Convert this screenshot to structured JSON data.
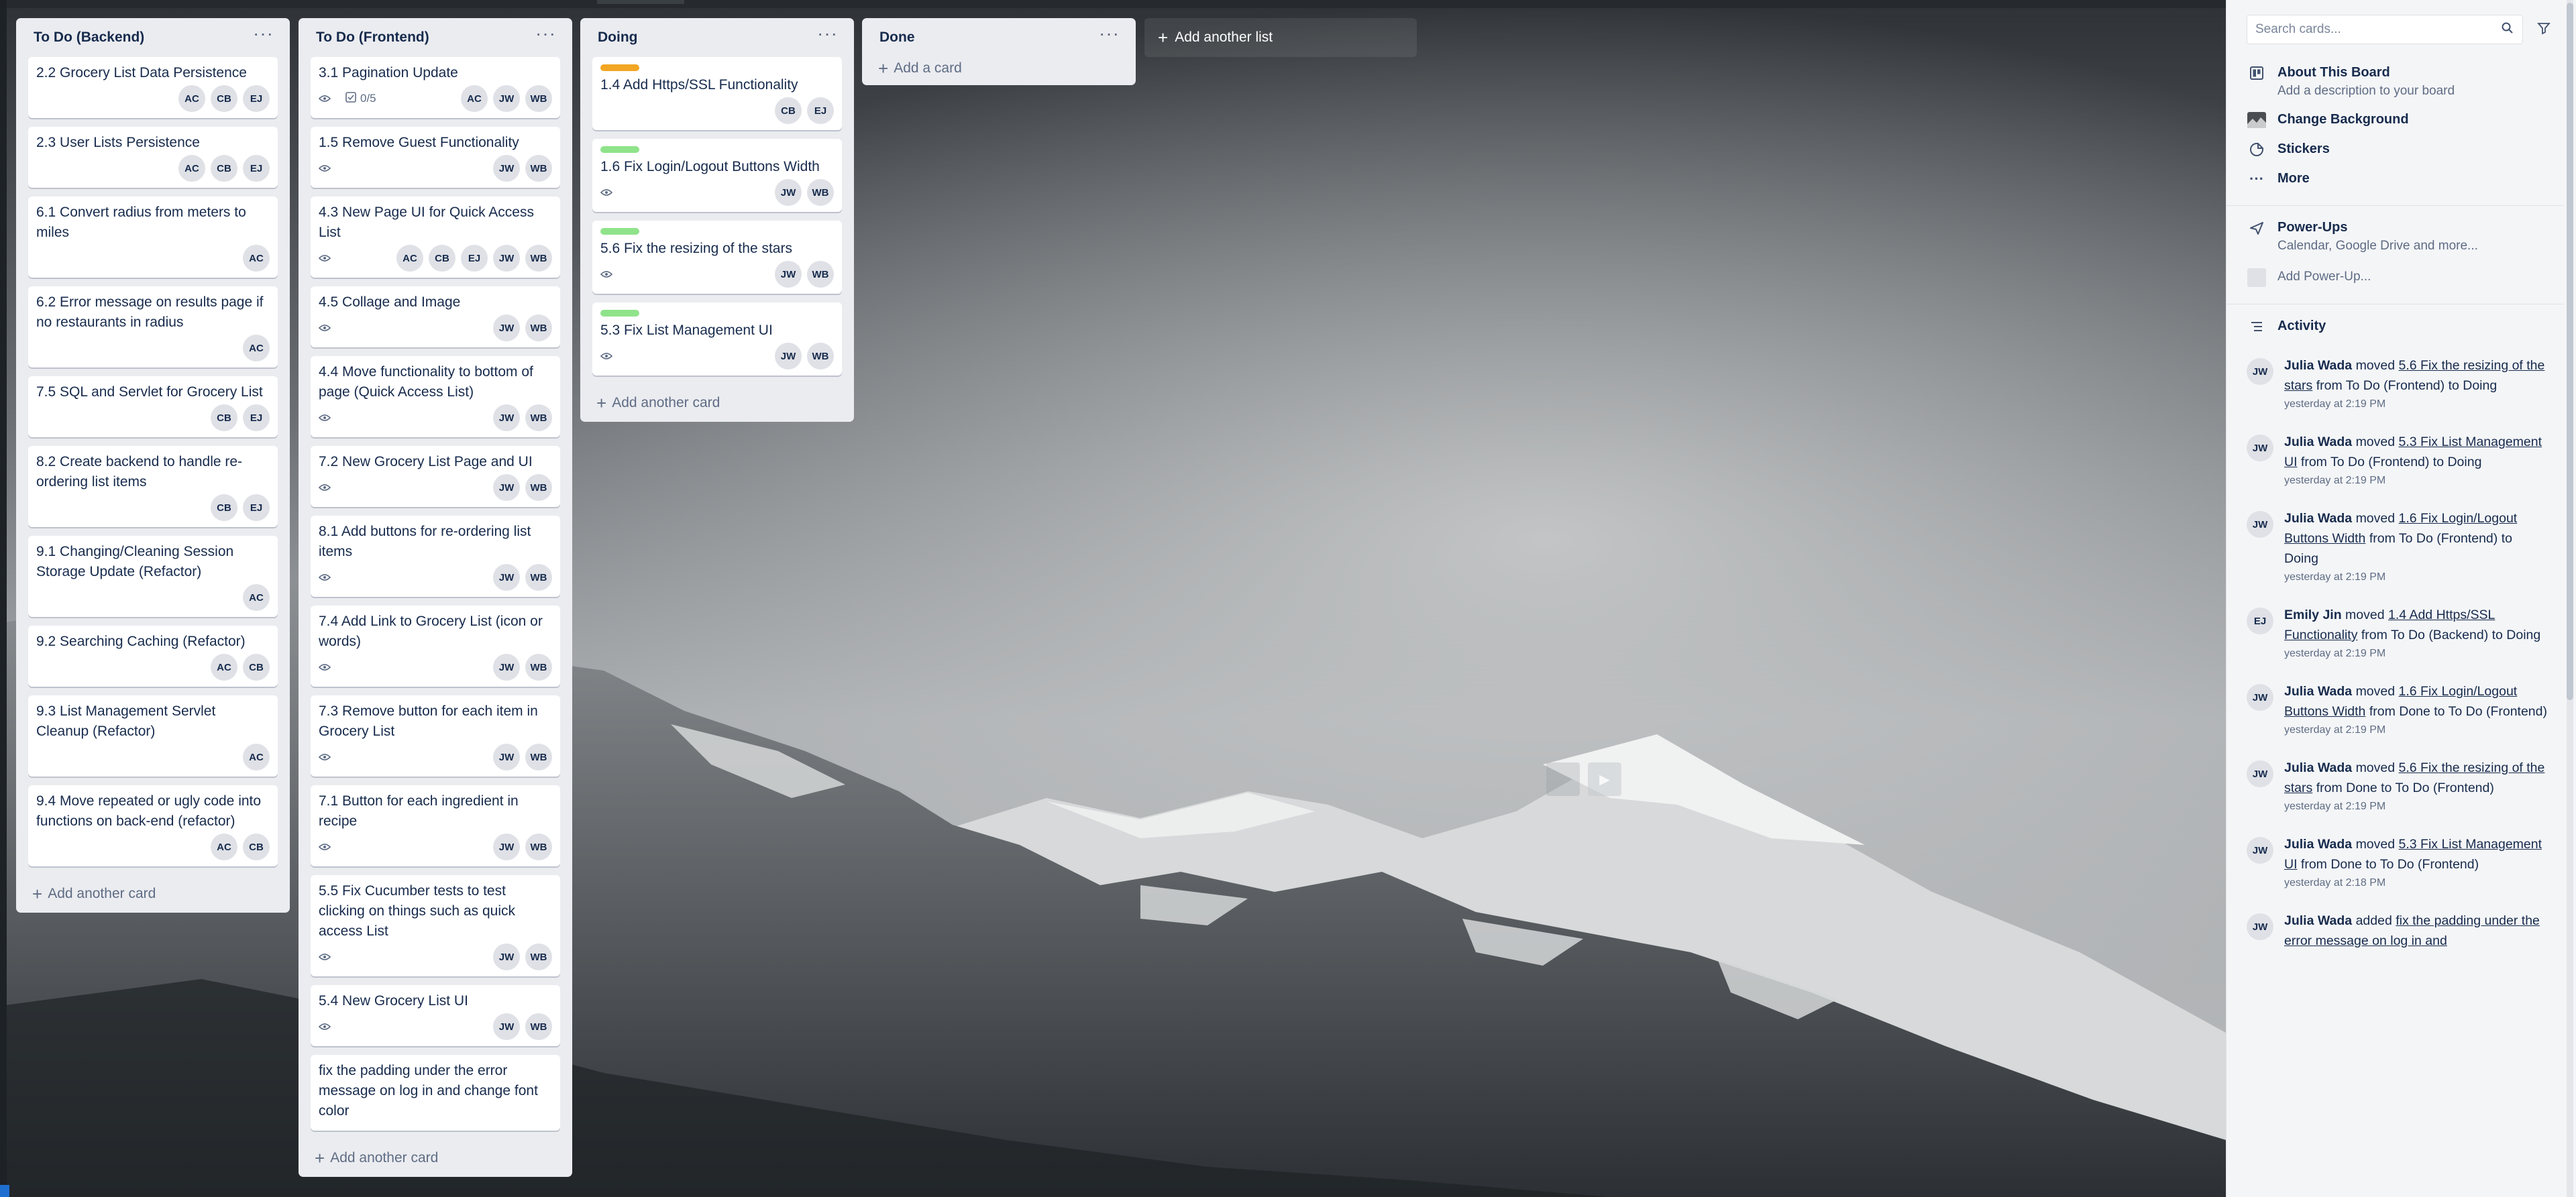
{
  "board": {
    "add_list_label": "Add another list",
    "lists": [
      {
        "title": "To Do (Backend)",
        "add_card_label": "Add another card",
        "cards": [
          {
            "title": "2.2 Grocery List Data Persistence",
            "members": [
              "AC",
              "CB",
              "EJ"
            ]
          },
          {
            "title": "2.3 User Lists Persistence",
            "members": [
              "AC",
              "CB",
              "EJ"
            ]
          },
          {
            "title": "6.1 Convert radius from meters to miles",
            "members": [
              "AC"
            ]
          },
          {
            "title": "6.2 Error message on results page if no restaurants in radius",
            "members": [
              "AC"
            ]
          },
          {
            "title": "7.5 SQL and Servlet for Grocery List",
            "members": [
              "CB",
              "EJ"
            ]
          },
          {
            "title": "8.2 Create backend to handle re-ordering list items",
            "members": [
              "CB",
              "EJ"
            ]
          },
          {
            "title": "9.1 Changing/Cleaning Session Storage Update (Refactor)",
            "members": [
              "AC"
            ]
          },
          {
            "title": "9.2 Searching Caching (Refactor)",
            "members": [
              "AC",
              "CB"
            ]
          },
          {
            "title": "9.3 List Management Servlet Cleanup (Refactor)",
            "members": [
              "AC"
            ]
          },
          {
            "title": "9.4 Move repeated or ugly code into functions on back-end (refactor)",
            "members": [
              "AC",
              "CB"
            ]
          }
        ]
      },
      {
        "title": "To Do (Frontend)",
        "add_card_label": "Add another card",
        "cards": [
          {
            "title": "3.1 Pagination Update",
            "watch": true,
            "checklist": "0/5",
            "members": [
              "AC",
              "JW",
              "WB"
            ]
          },
          {
            "title": "1.5 Remove Guest Functionality",
            "watch": true,
            "members": [
              "JW",
              "WB"
            ]
          },
          {
            "title": "4.3 New Page UI for Quick Access List",
            "watch": true,
            "members": [
              "AC",
              "CB",
              "EJ",
              "JW",
              "WB"
            ]
          },
          {
            "title": "4.5 Collage and Image",
            "watch": true,
            "members": [
              "JW",
              "WB"
            ]
          },
          {
            "title": "4.4 Move functionality to bottom of page (Quick Access List)",
            "watch": true,
            "members": [
              "JW",
              "WB"
            ]
          },
          {
            "title": "7.2 New Grocery List Page and UI",
            "watch": true,
            "members": [
              "JW",
              "WB"
            ]
          },
          {
            "title": "8.1 Add buttons for re-ordering list items",
            "watch": true,
            "members": [
              "JW",
              "WB"
            ]
          },
          {
            "title": "7.4 Add Link to Grocery List (icon or words)",
            "watch": true,
            "members": [
              "JW",
              "WB"
            ]
          },
          {
            "title": "7.3 Remove button for each item in Grocery List",
            "watch": true,
            "members": [
              "JW",
              "WB"
            ]
          },
          {
            "title": "7.1 Button for each ingredient in recipe",
            "watch": true,
            "members": [
              "JW",
              "WB"
            ]
          },
          {
            "title": "5.5 Fix Cucumber tests to test clicking on things such as quick access List",
            "watch": true,
            "members": [
              "JW",
              "WB"
            ]
          },
          {
            "title": "5.4 New Grocery List UI",
            "watch": true,
            "members": [
              "JW",
              "WB"
            ]
          },
          {
            "title": "fix the padding under the error message on log in and change font color",
            "members": []
          }
        ]
      },
      {
        "title": "Doing",
        "add_card_label": "Add another card",
        "cards": [
          {
            "title": "1.4 Add Https/SSL Functionality",
            "label_color": "#f2a623",
            "members": [
              "CB",
              "EJ"
            ]
          },
          {
            "title": "1.6 Fix Login/Logout Buttons Width",
            "label_color": "#8fe38a",
            "watch": true,
            "members": [
              "JW",
              "WB"
            ]
          },
          {
            "title": "5.6 Fix the resizing of the stars",
            "label_color": "#8fe38a",
            "watch": true,
            "members": [
              "JW",
              "WB"
            ]
          },
          {
            "title": "5.3 Fix List Management UI",
            "label_color": "#8fe38a",
            "watch": true,
            "members": [
              "JW",
              "WB"
            ]
          }
        ]
      },
      {
        "title": "Done",
        "add_card_label": "Add a card",
        "cards": []
      }
    ]
  },
  "sidebar": {
    "search_placeholder": "Search cards...",
    "menu": [
      {
        "icon": "board-icon",
        "title": "About This Board",
        "desc": "Add a description to your board"
      },
      {
        "icon": "background-thumbnail-icon",
        "title": "Change Background",
        "desc": ""
      },
      {
        "icon": "sticker-icon",
        "title": "Stickers",
        "desc": ""
      },
      {
        "icon": "more-icon",
        "title": "More",
        "desc": ""
      }
    ],
    "powerups": {
      "title": "Power-Ups",
      "desc": "Calendar, Google Drive and more...",
      "add_label": "Add Power-Up..."
    },
    "activity_title": "Activity",
    "activity": [
      {
        "initials": "JW",
        "user": "Julia Wada",
        "verb": "moved",
        "card": "5.6 Fix the resizing of the stars",
        "rest": "from To Do (Frontend) to Doing",
        "time": "yesterday at 2:19 PM"
      },
      {
        "initials": "JW",
        "user": "Julia Wada",
        "verb": "moved",
        "card": "5.3 Fix List Management UI",
        "rest": "from To Do (Frontend) to Doing",
        "time": "yesterday at 2:19 PM"
      },
      {
        "initials": "JW",
        "user": "Julia Wada",
        "verb": "moved",
        "card": "1.6 Fix Login/Logout Buttons Width",
        "rest": "from To Do (Frontend) to Doing",
        "time": "yesterday at 2:19 PM"
      },
      {
        "initials": "EJ",
        "user": "Emily Jin",
        "verb": "moved",
        "card": "1.4 Add Https/SSL Functionality",
        "rest": "from To Do (Backend) to Doing",
        "time": "yesterday at 2:19 PM"
      },
      {
        "initials": "JW",
        "user": "Julia Wada",
        "verb": "moved",
        "card": "1.6 Fix Login/Logout Buttons Width",
        "rest": "from Done to To Do (Frontend)",
        "time": "yesterday at 2:19 PM"
      },
      {
        "initials": "JW",
        "user": "Julia Wada",
        "verb": "moved",
        "card": "5.6 Fix the resizing of the stars",
        "rest": "from Done to To Do (Frontend)",
        "time": "yesterday at 2:19 PM"
      },
      {
        "initials": "JW",
        "user": "Julia Wada",
        "verb": "moved",
        "card": "5.3 Fix List Management UI",
        "rest": "from Done to To Do (Frontend)",
        "time": "yesterday at 2:18 PM"
      },
      {
        "initials": "JW",
        "user": "Julia Wada",
        "verb": "added",
        "card": "fix the padding under the error message on log in and",
        "rest": "",
        "time": ""
      }
    ]
  }
}
